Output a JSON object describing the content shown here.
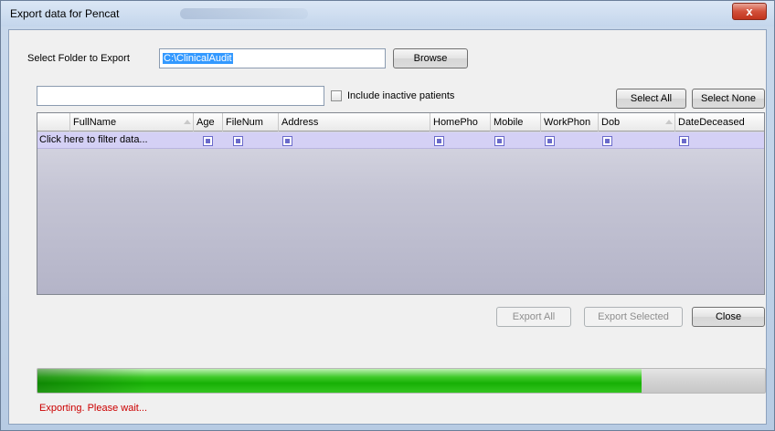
{
  "window": {
    "title": "Export data for Pencat",
    "close_glyph": "x"
  },
  "folder": {
    "label": "Select Folder to Export",
    "value": "C:\\ClinicalAudit",
    "browse_label": "Browse"
  },
  "filter": {
    "search_value": "",
    "include_inactive_label": "Include inactive patients",
    "include_inactive_checked": false,
    "select_all_label": "Select All",
    "select_none_label": "Select None"
  },
  "grid": {
    "columns": [
      {
        "label": "FullName"
      },
      {
        "label": "Age"
      },
      {
        "label": "FileNum"
      },
      {
        "label": "Address"
      },
      {
        "label": "HomePho"
      },
      {
        "label": "Mobile"
      },
      {
        "label": "WorkPhon"
      },
      {
        "label": "Dob"
      },
      {
        "label": "DateDeceased"
      }
    ],
    "filter_row_text": "Click here to filter data..."
  },
  "actions": {
    "export_all_label": "Export All",
    "export_selected_label": "Export Selected",
    "close_label": "Close"
  },
  "progress": {
    "percent": 83
  },
  "status": {
    "text": "Exporting. Please wait...",
    "color": "#cc0000"
  }
}
